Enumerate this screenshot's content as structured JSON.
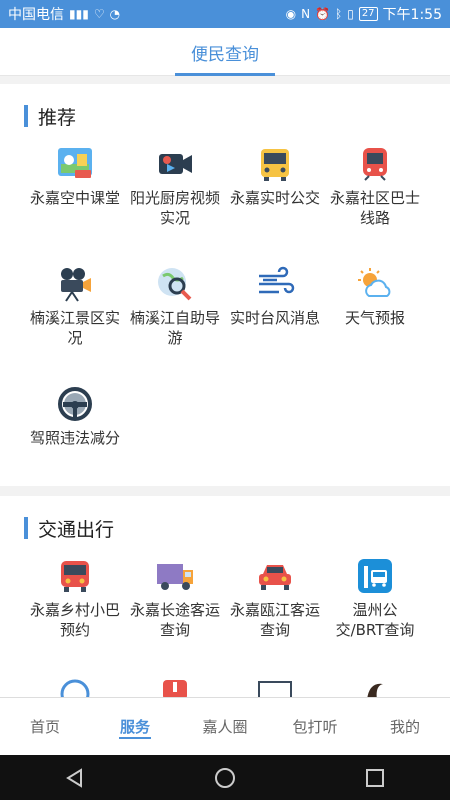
{
  "status": {
    "carrier": "中国电信",
    "battery": "27",
    "time": "下午1:55"
  },
  "header": {
    "tab_label": "便民查询"
  },
  "recommend": {
    "title": "推荐",
    "items": [
      {
        "label": "永嘉空中课堂",
        "icon": "classroom-icon"
      },
      {
        "label": "阳光厨房视频实况",
        "icon": "video-camera-icon"
      },
      {
        "label": "永嘉实时公交",
        "icon": "bus-icon"
      },
      {
        "label": "永嘉社区巴士线路",
        "icon": "train-icon"
      },
      {
        "label": "楠溪江景区实况",
        "icon": "film-camera-icon"
      },
      {
        "label": "楠溪江自助导游",
        "icon": "map-search-icon"
      },
      {
        "label": "实时台风消息",
        "icon": "wind-icon"
      },
      {
        "label": "天气预报",
        "icon": "weather-icon"
      },
      {
        "label": "驾照违法减分",
        "icon": "steering-wheel-icon"
      }
    ]
  },
  "traffic": {
    "title": "交通出行",
    "items": [
      {
        "label": "永嘉乡村小巴预约",
        "icon": "minibus-icon"
      },
      {
        "label": "永嘉长途客运查询",
        "icon": "truck-icon"
      },
      {
        "label": "永嘉瓯江客运查询",
        "icon": "car-icon"
      },
      {
        "label": "温州公交/BRT查询",
        "icon": "bus-stop-icon"
      }
    ]
  },
  "bottom_nav": [
    {
      "label": "首页"
    },
    {
      "label": "服务"
    },
    {
      "label": "嘉人圈"
    },
    {
      "label": "包打听"
    },
    {
      "label": "我的"
    }
  ],
  "colors": {
    "accent": "#4a90d9"
  }
}
